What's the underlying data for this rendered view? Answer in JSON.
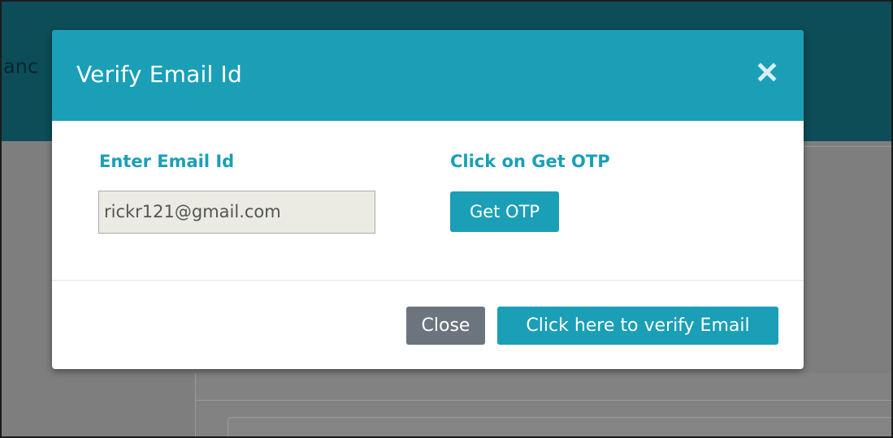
{
  "background": {
    "header_fragment": "anc"
  },
  "modal": {
    "title": "Verify Email Id",
    "close_icon": "close-x-icon",
    "email_label": "Enter Email Id",
    "email_value": "rickr121@gmail.com",
    "otp_label": "Click on Get OTP",
    "get_otp_label": "Get OTP",
    "close_label": "Close",
    "verify_label": "Click here to verify Email"
  },
  "colors": {
    "accent": "#1a9fb7",
    "header_bg": "#0c4d57",
    "close_button": "#6c757d",
    "input_bg": "#ebebe4"
  }
}
